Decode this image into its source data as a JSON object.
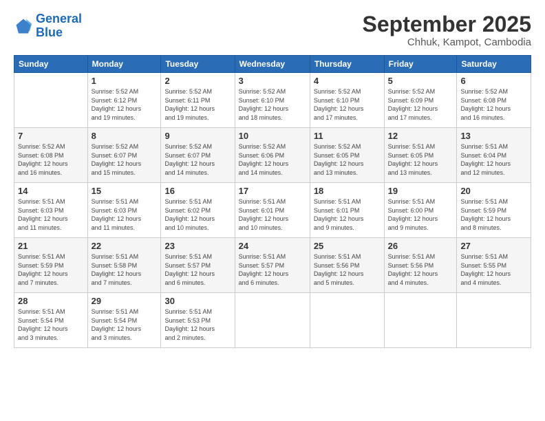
{
  "logo": {
    "line1": "General",
    "line2": "Blue"
  },
  "title": "September 2025",
  "subtitle": "Chhuk, Kampot, Cambodia",
  "columns": [
    "Sunday",
    "Monday",
    "Tuesday",
    "Wednesday",
    "Thursday",
    "Friday",
    "Saturday"
  ],
  "weeks": [
    [
      {
        "day": "",
        "info": ""
      },
      {
        "day": "1",
        "info": "Sunrise: 5:52 AM\nSunset: 6:12 PM\nDaylight: 12 hours\nand 19 minutes."
      },
      {
        "day": "2",
        "info": "Sunrise: 5:52 AM\nSunset: 6:11 PM\nDaylight: 12 hours\nand 19 minutes."
      },
      {
        "day": "3",
        "info": "Sunrise: 5:52 AM\nSunset: 6:10 PM\nDaylight: 12 hours\nand 18 minutes."
      },
      {
        "day": "4",
        "info": "Sunrise: 5:52 AM\nSunset: 6:10 PM\nDaylight: 12 hours\nand 17 minutes."
      },
      {
        "day": "5",
        "info": "Sunrise: 5:52 AM\nSunset: 6:09 PM\nDaylight: 12 hours\nand 17 minutes."
      },
      {
        "day": "6",
        "info": "Sunrise: 5:52 AM\nSunset: 6:08 PM\nDaylight: 12 hours\nand 16 minutes."
      }
    ],
    [
      {
        "day": "7",
        "info": "Sunrise: 5:52 AM\nSunset: 6:08 PM\nDaylight: 12 hours\nand 16 minutes."
      },
      {
        "day": "8",
        "info": "Sunrise: 5:52 AM\nSunset: 6:07 PM\nDaylight: 12 hours\nand 15 minutes."
      },
      {
        "day": "9",
        "info": "Sunrise: 5:52 AM\nSunset: 6:07 PM\nDaylight: 12 hours\nand 14 minutes."
      },
      {
        "day": "10",
        "info": "Sunrise: 5:52 AM\nSunset: 6:06 PM\nDaylight: 12 hours\nand 14 minutes."
      },
      {
        "day": "11",
        "info": "Sunrise: 5:52 AM\nSunset: 6:05 PM\nDaylight: 12 hours\nand 13 minutes."
      },
      {
        "day": "12",
        "info": "Sunrise: 5:51 AM\nSunset: 6:05 PM\nDaylight: 12 hours\nand 13 minutes."
      },
      {
        "day": "13",
        "info": "Sunrise: 5:51 AM\nSunset: 6:04 PM\nDaylight: 12 hours\nand 12 minutes."
      }
    ],
    [
      {
        "day": "14",
        "info": "Sunrise: 5:51 AM\nSunset: 6:03 PM\nDaylight: 12 hours\nand 11 minutes."
      },
      {
        "day": "15",
        "info": "Sunrise: 5:51 AM\nSunset: 6:03 PM\nDaylight: 12 hours\nand 11 minutes."
      },
      {
        "day": "16",
        "info": "Sunrise: 5:51 AM\nSunset: 6:02 PM\nDaylight: 12 hours\nand 10 minutes."
      },
      {
        "day": "17",
        "info": "Sunrise: 5:51 AM\nSunset: 6:01 PM\nDaylight: 12 hours\nand 10 minutes."
      },
      {
        "day": "18",
        "info": "Sunrise: 5:51 AM\nSunset: 6:01 PM\nDaylight: 12 hours\nand 9 minutes."
      },
      {
        "day": "19",
        "info": "Sunrise: 5:51 AM\nSunset: 6:00 PM\nDaylight: 12 hours\nand 9 minutes."
      },
      {
        "day": "20",
        "info": "Sunrise: 5:51 AM\nSunset: 5:59 PM\nDaylight: 12 hours\nand 8 minutes."
      }
    ],
    [
      {
        "day": "21",
        "info": "Sunrise: 5:51 AM\nSunset: 5:59 PM\nDaylight: 12 hours\nand 7 minutes."
      },
      {
        "day": "22",
        "info": "Sunrise: 5:51 AM\nSunset: 5:58 PM\nDaylight: 12 hours\nand 7 minutes."
      },
      {
        "day": "23",
        "info": "Sunrise: 5:51 AM\nSunset: 5:57 PM\nDaylight: 12 hours\nand 6 minutes."
      },
      {
        "day": "24",
        "info": "Sunrise: 5:51 AM\nSunset: 5:57 PM\nDaylight: 12 hours\nand 6 minutes."
      },
      {
        "day": "25",
        "info": "Sunrise: 5:51 AM\nSunset: 5:56 PM\nDaylight: 12 hours\nand 5 minutes."
      },
      {
        "day": "26",
        "info": "Sunrise: 5:51 AM\nSunset: 5:56 PM\nDaylight: 12 hours\nand 4 minutes."
      },
      {
        "day": "27",
        "info": "Sunrise: 5:51 AM\nSunset: 5:55 PM\nDaylight: 12 hours\nand 4 minutes."
      }
    ],
    [
      {
        "day": "28",
        "info": "Sunrise: 5:51 AM\nSunset: 5:54 PM\nDaylight: 12 hours\nand 3 minutes."
      },
      {
        "day": "29",
        "info": "Sunrise: 5:51 AM\nSunset: 5:54 PM\nDaylight: 12 hours\nand 3 minutes."
      },
      {
        "day": "30",
        "info": "Sunrise: 5:51 AM\nSunset: 5:53 PM\nDaylight: 12 hours\nand 2 minutes."
      },
      {
        "day": "",
        "info": ""
      },
      {
        "day": "",
        "info": ""
      },
      {
        "day": "",
        "info": ""
      },
      {
        "day": "",
        "info": ""
      }
    ]
  ]
}
